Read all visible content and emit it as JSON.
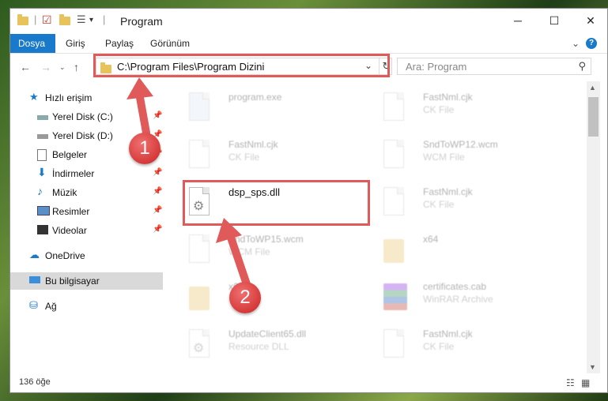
{
  "window": {
    "title": "Program",
    "minimize": "─",
    "maximize": "☐",
    "close": "✕"
  },
  "ribbon": {
    "tabs": [
      "Dosya",
      "Giriş",
      "Paylaş",
      "Görünüm"
    ],
    "expand": "⌄",
    "help": "?"
  },
  "address": {
    "path": "C:\\Program Files\\Program Dizini",
    "dropdown": "⌄",
    "refresh": "↻"
  },
  "search": {
    "placeholder": "Ara: Program",
    "icon": "search-icon"
  },
  "nav": {
    "items": [
      {
        "label": "Hızlı erişim",
        "icon": "star-icon"
      },
      {
        "label": "Yerel Disk (C:)",
        "icon": "drive-icon",
        "pinned": true
      },
      {
        "label": "Yerel Disk (D:)",
        "icon": "drive-icon",
        "pinned": true
      },
      {
        "label": "Belgeler",
        "icon": "documents-icon",
        "pinned": true
      },
      {
        "label": "İndirmeler",
        "icon": "download-icon",
        "pinned": true
      },
      {
        "label": "Müzik",
        "icon": "music-icon",
        "pinned": true
      },
      {
        "label": "Resimler",
        "icon": "pictures-icon",
        "pinned": true
      },
      {
        "label": "Videolar",
        "icon": "video-icon",
        "pinned": true
      },
      {
        "label": "OneDrive",
        "icon": "cloud-icon"
      },
      {
        "label": "Bu bilgisayar",
        "icon": "computer-icon"
      },
      {
        "label": "Ağ",
        "icon": "network-icon"
      }
    ]
  },
  "files": [
    {
      "name": "program.exe",
      "type": ""
    },
    {
      "name": "FastNml.cjk",
      "type": "CK File"
    },
    {
      "name": "FastNml.cjk",
      "type": "CK File"
    },
    {
      "name": "SndToWP12.wcm",
      "type": "WCM File"
    },
    {
      "name": "dsp_sps.dll",
      "type": ""
    },
    {
      "name": "FastNml.cjk",
      "type": "CK File"
    },
    {
      "name": "SndToWP15.wcm",
      "type": "WCM File"
    },
    {
      "name": "x64",
      "type": ""
    },
    {
      "name": "x64",
      "type": ""
    },
    {
      "name": "certificates.cab",
      "type": "WinRAR Archive"
    },
    {
      "name": "UpdateClient65.dll",
      "type": "Resource DLL"
    },
    {
      "name": "FastNml.cjk",
      "type": "CK File"
    }
  ],
  "status": {
    "count": "136 öğe"
  },
  "annotations": {
    "badge1": "1",
    "badge2": "2"
  },
  "colors": {
    "accent": "#1979ca",
    "annotation": "#e05a5a"
  }
}
